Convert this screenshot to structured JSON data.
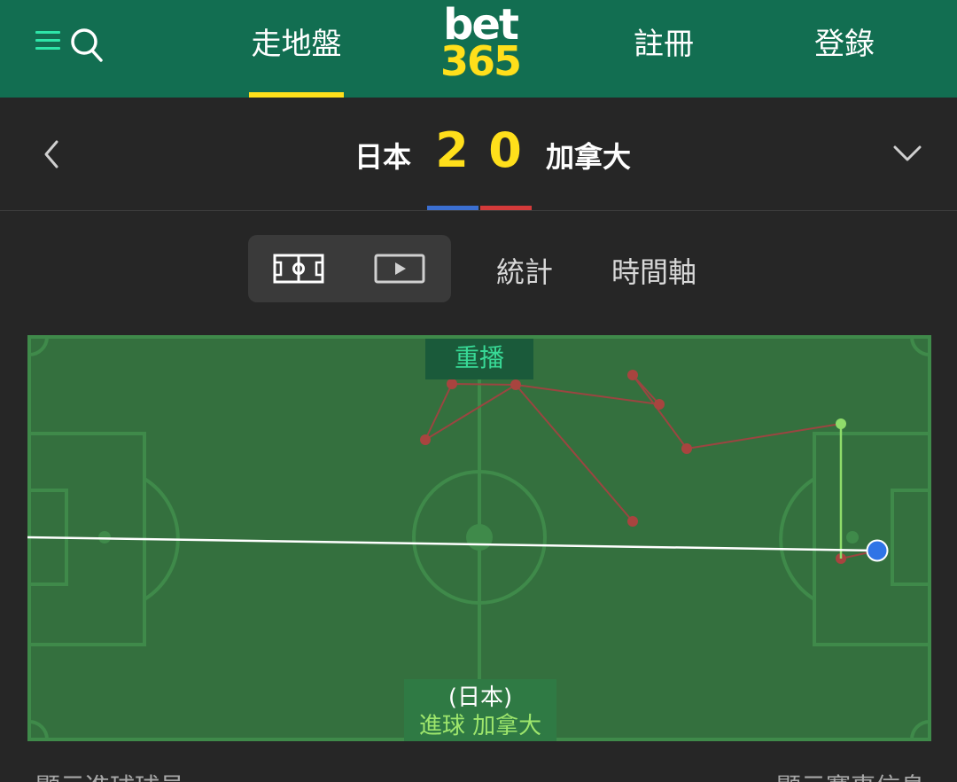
{
  "header": {
    "nav_inplay": "走地盤",
    "nav_register": "註冊",
    "nav_login": "登錄",
    "logo_top": "bet",
    "logo_bottom": "365",
    "accent_color": "#ffdf1b",
    "bg_color": "#126e51"
  },
  "match": {
    "home_team": "日本",
    "away_team": "加拿大",
    "home_score": "2",
    "away_score": "0",
    "home_color": "#3b6fd1",
    "away_color": "#d33a3a"
  },
  "tabs": {
    "stats": "統計",
    "timeline": "時間軸"
  },
  "pitch": {
    "replay_label": "重播",
    "event_team": "(日本)",
    "event_desc": "進球  加拿大"
  },
  "footer": {
    "left_link": "顯示進球球員",
    "right_link": "顯示賽事信息"
  }
}
